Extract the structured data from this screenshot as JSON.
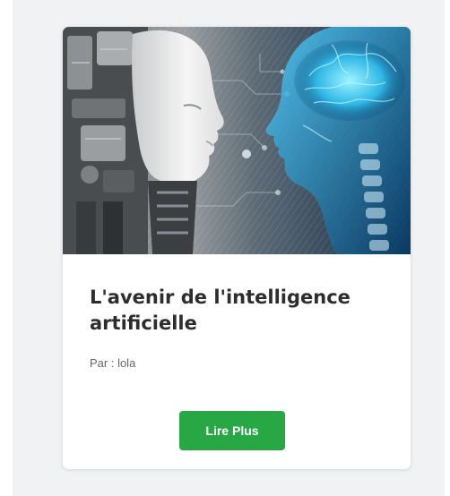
{
  "card": {
    "image_alt": "Illustration intelligence artificielle : robot et cerveau",
    "title": "L'avenir de l'intelligence artificielle",
    "author": "Par : lola",
    "button_label": "Lire Plus"
  },
  "colors": {
    "panel_background": "#f1f2f4",
    "card_background": "#ffffff",
    "button_background": "#28a745",
    "title_text": "#2d2d2d",
    "author_text": "#666666"
  }
}
